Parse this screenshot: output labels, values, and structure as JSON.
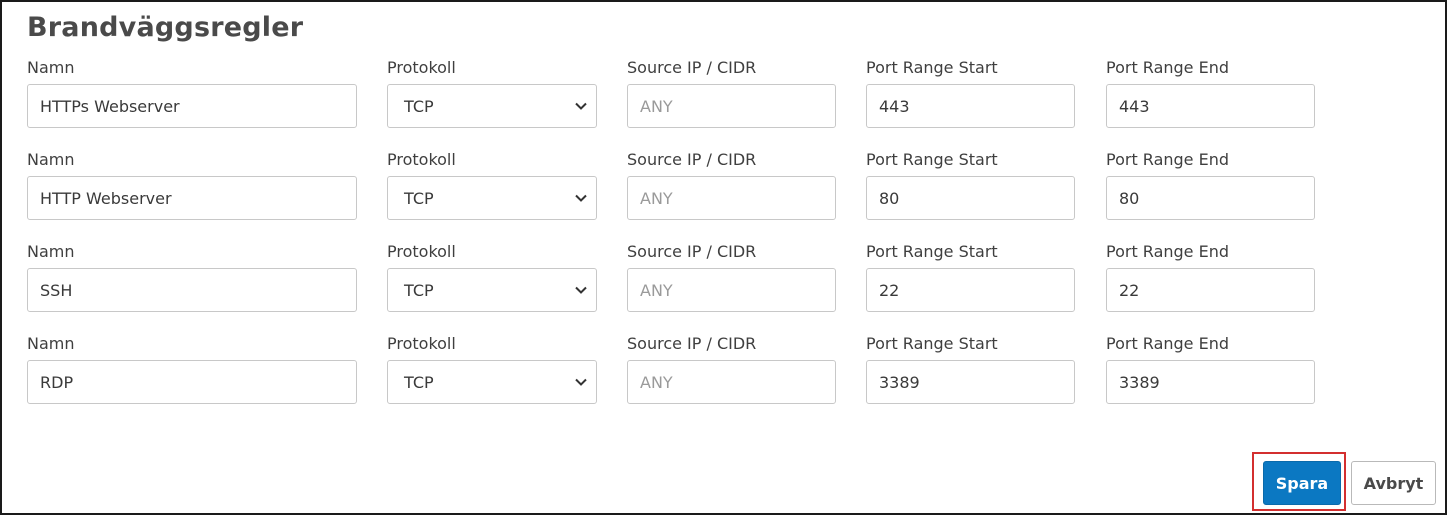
{
  "page": {
    "title": "Brandväggsregler"
  },
  "labels": {
    "name": "Namn",
    "protocol": "Protokoll",
    "source": "Source IP / CIDR",
    "port_start": "Port Range Start",
    "port_end": "Port Range End"
  },
  "rules": [
    {
      "name": "HTTPs Webserver",
      "protocol": "TCP",
      "source_placeholder": "ANY",
      "port_start": "443",
      "port_end": "443"
    },
    {
      "name": "HTTP Webserver",
      "protocol": "TCP",
      "source_placeholder": "ANY",
      "port_start": "80",
      "port_end": "80"
    },
    {
      "name": "SSH",
      "protocol": "TCP",
      "source_placeholder": "ANY",
      "port_start": "22",
      "port_end": "22"
    },
    {
      "name": "RDP",
      "protocol": "TCP",
      "source_placeholder": "ANY",
      "port_start": "3389",
      "port_end": "3389"
    }
  ],
  "actions": {
    "save_label": "Spara",
    "cancel_label": "Avbryt"
  },
  "icons": {
    "select_caret": "chevron-down-icon"
  },
  "colors": {
    "primary": "#0b78c2",
    "highlight": "#d32f2f"
  }
}
